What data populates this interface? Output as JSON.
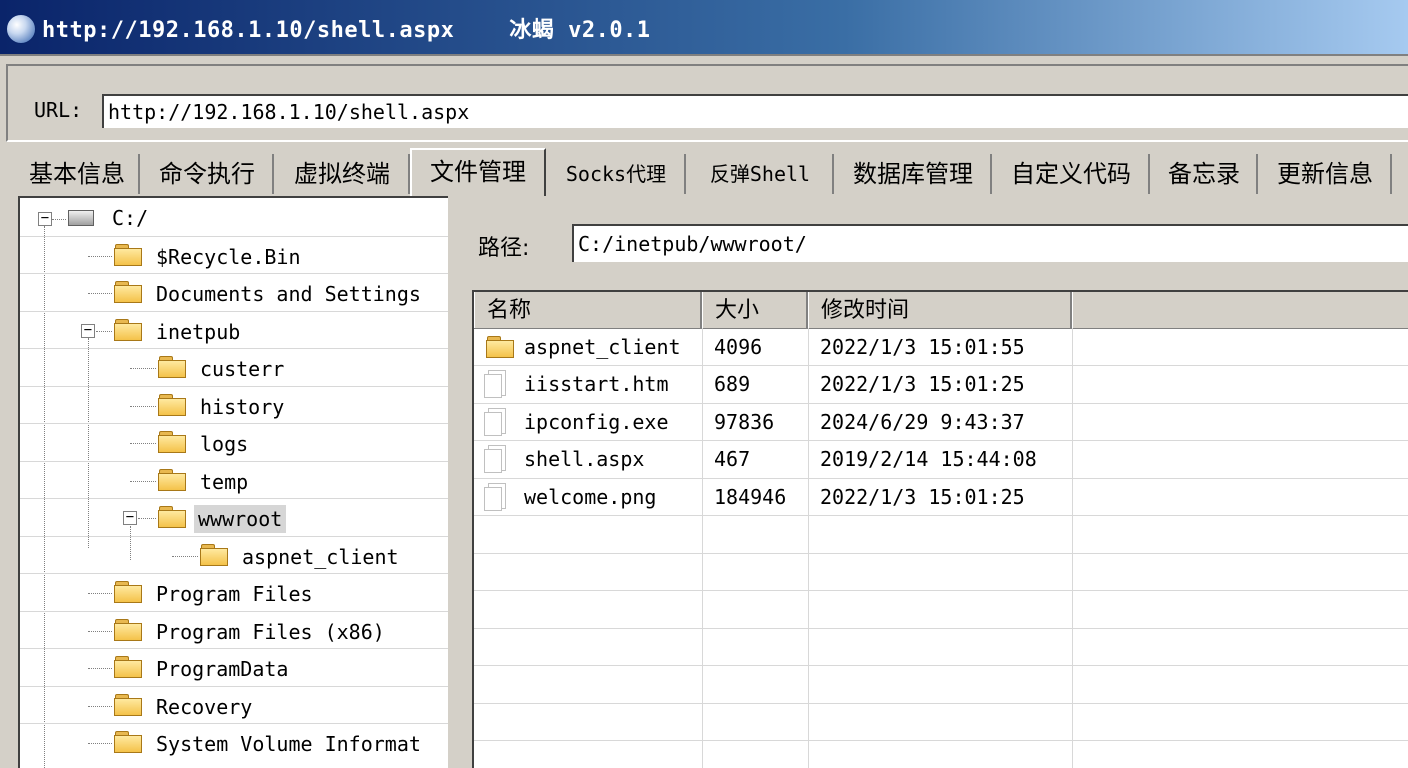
{
  "window": {
    "title": "http://192.168.1.10/shell.aspx    冰蝎 v2.0.1"
  },
  "url_bar": {
    "label": "URL:",
    "value": "http://192.168.1.10/shell.aspx"
  },
  "tabs": [
    {
      "label": "基本信息"
    },
    {
      "label": "命令执行"
    },
    {
      "label": "虚拟终端"
    },
    {
      "label": "文件管理",
      "active": true
    },
    {
      "label": "Socks代理"
    },
    {
      "label": "反弹Shell"
    },
    {
      "label": "数据库管理"
    },
    {
      "label": "自定义代码"
    },
    {
      "label": "备忘录"
    },
    {
      "label": "更新信息"
    }
  ],
  "tree": {
    "root": {
      "label": "C:/",
      "icon": "drive-icon"
    },
    "items": [
      {
        "label": "$Recycle.Bin",
        "icon": "folder-icon"
      },
      {
        "label": "Documents and Settings",
        "icon": "folder-icon"
      },
      {
        "label": "inetpub",
        "icon": "folder-icon",
        "expanded": true
      },
      {
        "label": "custerr",
        "icon": "folder-icon"
      },
      {
        "label": "history",
        "icon": "folder-icon"
      },
      {
        "label": "logs",
        "icon": "folder-icon"
      },
      {
        "label": "temp",
        "icon": "folder-icon"
      },
      {
        "label": "wwwroot",
        "icon": "folder-icon",
        "expanded": true,
        "selected": true
      },
      {
        "label": "aspnet_client",
        "icon": "folder-icon"
      },
      {
        "label": "Program Files",
        "icon": "folder-icon"
      },
      {
        "label": "Program Files (x86)",
        "icon": "folder-icon"
      },
      {
        "label": "ProgramData",
        "icon": "folder-icon"
      },
      {
        "label": "Recovery",
        "icon": "folder-icon"
      },
      {
        "label": "System Volume Informat",
        "icon": "folder-icon"
      }
    ]
  },
  "path": {
    "label": "路径:",
    "value": "C:/inetpub/wwwroot/"
  },
  "file_table": {
    "columns": [
      "名称",
      "大小",
      "修改时间"
    ],
    "rows": [
      {
        "name": "aspnet_client",
        "size": "4096",
        "modified": "2022/1/3 15:01:55",
        "icon": "folder-icon"
      },
      {
        "name": "iisstart.htm",
        "size": "689",
        "modified": "2022/1/3 15:01:25",
        "icon": "file-icon"
      },
      {
        "name": "ipconfig.exe",
        "size": "97836",
        "modified": "2024/6/29 9:43:37",
        "icon": "file-icon"
      },
      {
        "name": "shell.aspx",
        "size": "467",
        "modified": "2019/2/14 15:44:08",
        "icon": "file-icon"
      },
      {
        "name": "welcome.png",
        "size": "184946",
        "modified": "2022/1/3 15:01:25",
        "icon": "file-icon"
      }
    ]
  }
}
